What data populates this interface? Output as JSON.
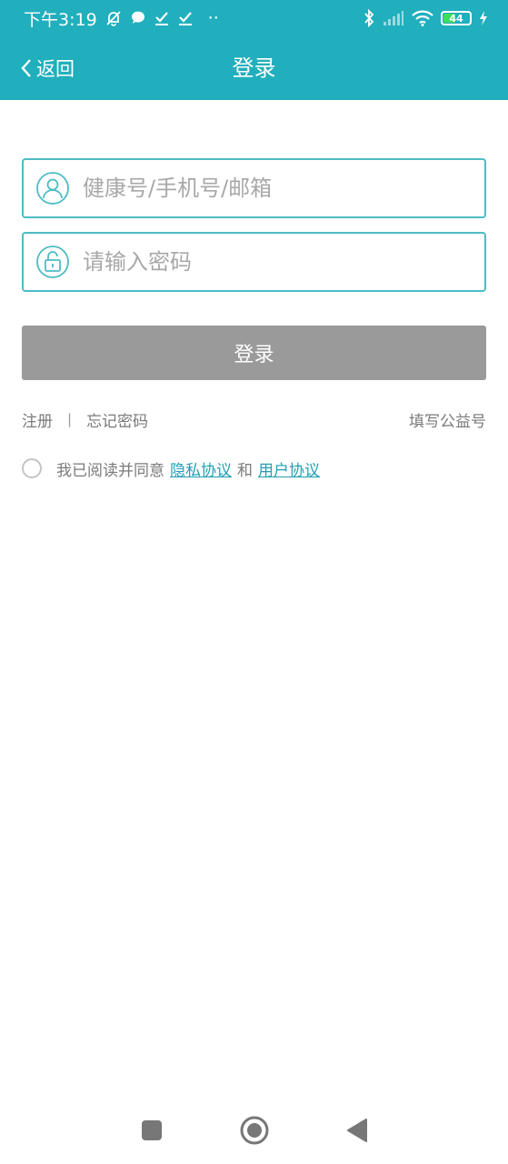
{
  "status_bar": {
    "time": "下午3:19",
    "dots": "··",
    "battery_level": "44",
    "colors": {
      "bar": "#21afbd",
      "battery_fill": "#3ddc5a"
    }
  },
  "nav": {
    "back_label": "返回",
    "title": "登录"
  },
  "form": {
    "account_placeholder": "健康号/手机号/邮箱",
    "account_icon": "user-icon",
    "password_placeholder": "请输入密码",
    "password_icon": "lock-icon",
    "login_button": "登录",
    "colors": {
      "field_border": "#4cbcc4",
      "button_bg": "#9a9a9a"
    }
  },
  "links": {
    "register": "注册",
    "separator": "|",
    "forgot_password": "忘记密码",
    "fill_public_number": "填写公益号"
  },
  "agreement": {
    "prefix": "我已阅读并同意",
    "privacy": "隐私协议",
    "and": "和",
    "user": "用户协议",
    "checked": false,
    "link_color": "#21a0b4"
  },
  "system_nav": {
    "icons": [
      "recent-apps-icon",
      "home-icon",
      "back-triangle-icon"
    ]
  }
}
